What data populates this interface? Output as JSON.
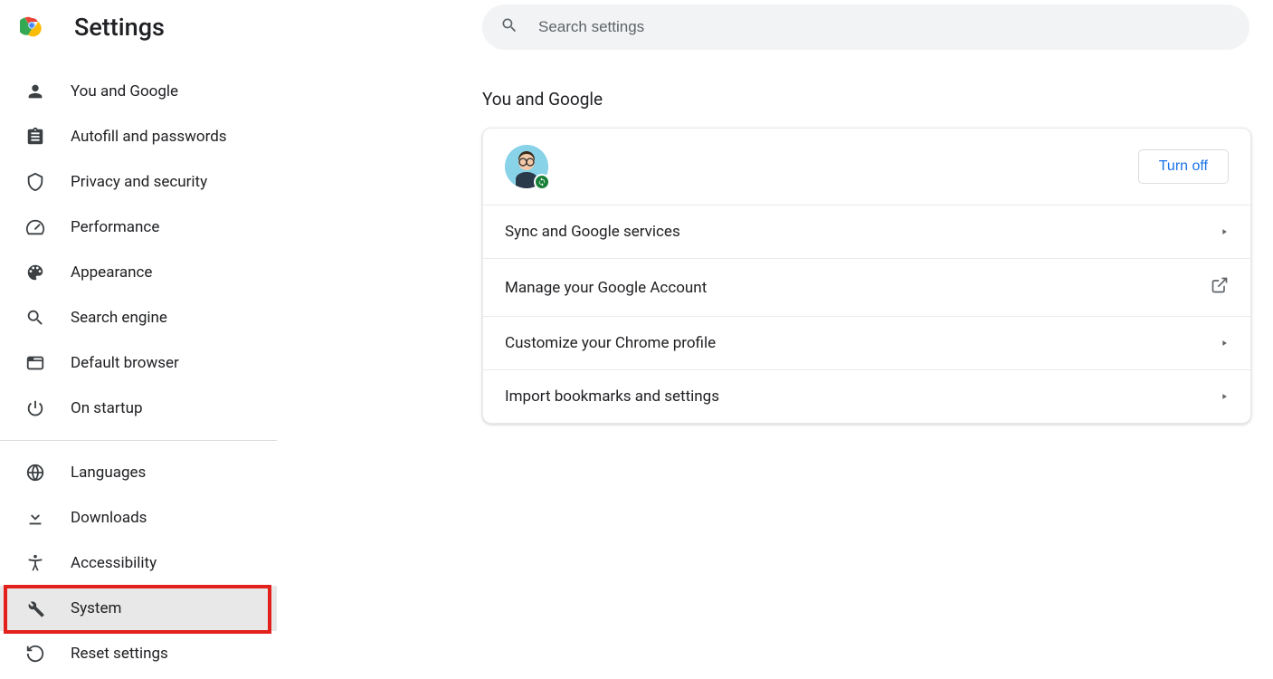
{
  "header": {
    "title": "Settings"
  },
  "search": {
    "placeholder": "Search settings"
  },
  "sidebar": {
    "group1": [
      {
        "label": "You and Google",
        "icon": "person"
      },
      {
        "label": "Autofill and passwords",
        "icon": "clipboard"
      },
      {
        "label": "Privacy and security",
        "icon": "shield"
      },
      {
        "label": "Performance",
        "icon": "speed"
      },
      {
        "label": "Appearance",
        "icon": "palette"
      },
      {
        "label": "Search engine",
        "icon": "search"
      },
      {
        "label": "Default browser",
        "icon": "browser"
      },
      {
        "label": "On startup",
        "icon": "power"
      }
    ],
    "group2": [
      {
        "label": "Languages",
        "icon": "globe"
      },
      {
        "label": "Downloads",
        "icon": "download"
      },
      {
        "label": "Accessibility",
        "icon": "accessibility"
      },
      {
        "label": "System",
        "icon": "wrench",
        "highlighted": true
      },
      {
        "label": "Reset settings",
        "icon": "restore"
      }
    ]
  },
  "main": {
    "section_title": "You and Google",
    "turnoff_label": "Turn off",
    "rows": [
      {
        "label": "Sync and Google services",
        "action": "arrow"
      },
      {
        "label": "Manage your Google Account",
        "action": "external"
      },
      {
        "label": "Customize your Chrome profile",
        "action": "arrow"
      },
      {
        "label": "Import bookmarks and settings",
        "action": "arrow"
      }
    ]
  }
}
